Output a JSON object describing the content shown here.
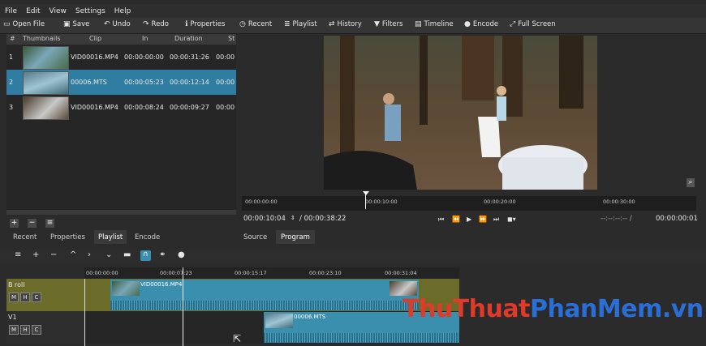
{
  "menu": [
    "File",
    "Edit",
    "View",
    "Settings",
    "Help"
  ],
  "toolbar": {
    "open_file": "Open File",
    "save": "Save",
    "undo": "Undo",
    "redo": "Redo",
    "properties": "Properties",
    "recent": "Recent",
    "playlist": "Playlist",
    "history": "History",
    "filters": "Filters",
    "timeline": "Timeline",
    "encode": "Encode",
    "full_screen": "Full Screen"
  },
  "playlist": {
    "columns": [
      "#",
      "Thumbnails",
      "Clip",
      "In",
      "Duration",
      "St"
    ],
    "rows": [
      {
        "num": "1",
        "clip": "VID00016.MP4",
        "in": "00:00:00:00",
        "duration": "00:00:31:26",
        "start": "00:00"
      },
      {
        "num": "2",
        "clip": "00006.MTS",
        "in": "00:00:05:23",
        "duration": "00:00:12:14",
        "start": "00:00"
      },
      {
        "num": "3",
        "clip": "VID00016.MP4",
        "in": "00:00:08:24",
        "duration": "00:00:09:27",
        "start": "00:00"
      }
    ],
    "selected_row": 1
  },
  "left_tabs": [
    "Recent",
    "Properties",
    "Playlist",
    "Encode"
  ],
  "player": {
    "ruler_labels": [
      "00:00:00:00",
      "00:00:10:00",
      "00:00:20:00",
      "00:00:30:00"
    ],
    "timecode": "00:00:10:04",
    "duration": "/ 00:00:38:22",
    "in_point": "--:--:--:-- /",
    "out_point": "00:00:00:01",
    "tabs": [
      "Source",
      "Program"
    ]
  },
  "timeline": {
    "ruler_labels": [
      "00:00:00:00",
      "00:00:07:23",
      "00:00:15:17",
      "00:00:23:10",
      "00:00:31:04"
    ],
    "tracks": [
      {
        "name": "B roll",
        "buttons": [
          "M",
          "H",
          "C"
        ],
        "clip": "VID00016.MP4"
      },
      {
        "name": "V1",
        "buttons": [
          "M",
          "H",
          "C"
        ],
        "clip": "00006.MTS"
      }
    ]
  },
  "watermark": {
    "part1": "ThuThuat",
    "part2": "PhanMem",
    "part3": ".vn"
  },
  "colors": {
    "selection": "#2f7da0",
    "clip_teal": "#3a8fae",
    "gap_olive": "#6b6b2a"
  }
}
